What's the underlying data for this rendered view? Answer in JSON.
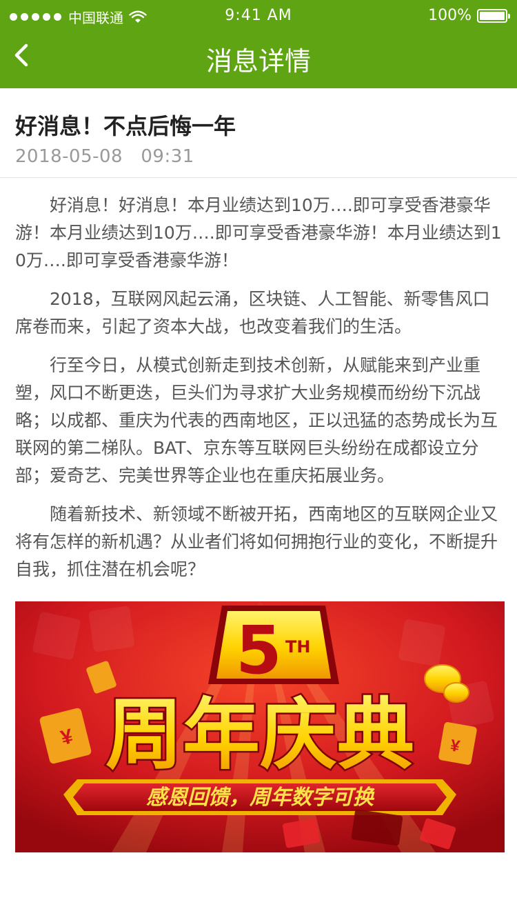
{
  "status_bar": {
    "carrier": "中国联通",
    "time": "9:41 AM",
    "battery": "100%"
  },
  "nav": {
    "title": "消息详情",
    "back_icon": "chevron-left-icon"
  },
  "article": {
    "title": "好消息！不点后悔一年",
    "datetime": "2018-05-08   09:31",
    "paragraphs": [
      "好消息！好消息！本月业绩达到10万….即可享受香港豪华游！本月业绩达到10万….即可享受香港豪华游！本月业绩达到10万….即可享受香港豪华游！",
      "2018，互联网风起云涌，区块链、人工智能、新零售风口席卷而来，引起了资本大战，也改变着我们的生活。",
      "行至今日，从模式创新走到技术创新，从赋能来到产业重塑，风口不断更迭，巨头们为寻求扩大业务规模而纷纷下沉战略；以成都、重庆为代表的西南地区，正以迅猛的态势成长为互联网的第二梯队。BAT、京东等互联网巨头纷纷在成都设立分部；爱奇艺、完美世界等企业也在重庆拓展业务。",
      "随着新技术、新领域不断被开拓，西南地区的互联网企业又将有怎样的新机遇？从业者们将如何拥抱行业的变化，不断提升自我，抓住潜在机会呢？"
    ]
  },
  "banner": {
    "badge_number": "5",
    "badge_suffix": "TH",
    "headline": "周年庆典",
    "subline": "感恩回馈，周年数字可换",
    "yen": "¥",
    "colors": {
      "bg": "#c8141c",
      "gold": "#ffd400",
      "ribbon": "#b00d14"
    }
  },
  "theme": {
    "accent": "#5fa413"
  }
}
